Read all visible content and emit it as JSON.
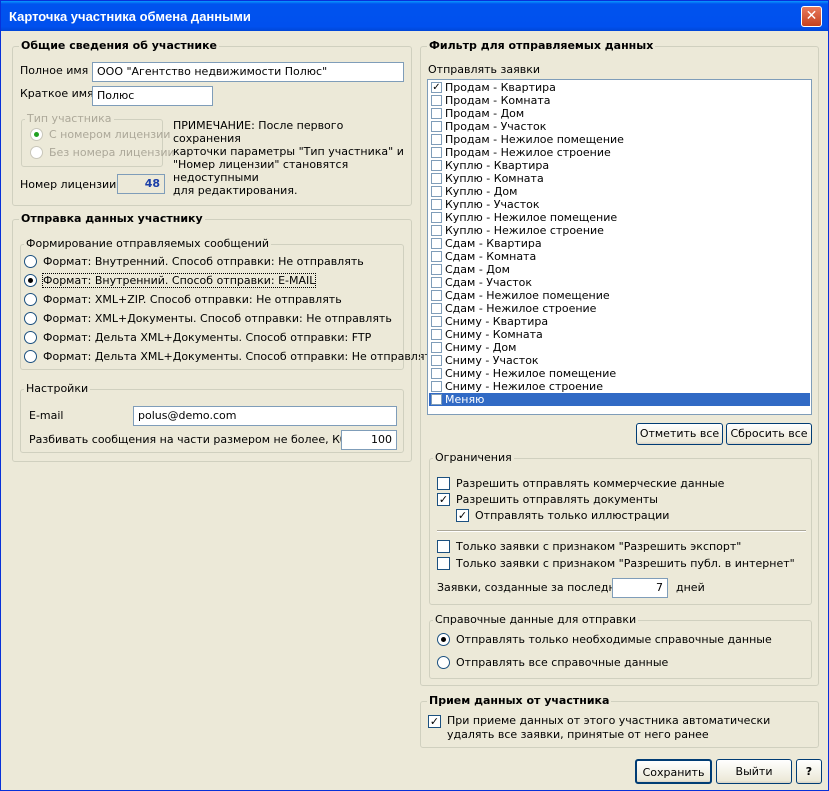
{
  "window": {
    "title": "Карточка участника обмена данными"
  },
  "general": {
    "legend": "Общие сведения об участнике",
    "full_name_label": "Полное имя",
    "full_name_value": "ООО \"Агентство недвижимости Полюс\"",
    "short_name_label": "Краткое имя",
    "short_name_value": "Полюс",
    "type_legend": "Тип участника",
    "type_options": [
      "С номером лицензии",
      "Без номера лицензии"
    ],
    "note_lines": [
      "ПРИМЕЧАНИЕ: После первого сохранения",
      "карточки параметры \"Тип участника\" и",
      "\"Номер лицензии\" становятся недоступными",
      "для редактирования."
    ],
    "license_label": "Номер лицензии",
    "license_value": "48"
  },
  "sending": {
    "legend": "Отправка данных участнику",
    "format_legend": "Формирование отправляемых сообщений",
    "format_options": [
      "Формат: Внутренний. Способ отправки: Не отправлять",
      "Формат: Внутренний. Способ отправки: E-MAIL",
      "Формат: XML+ZIP. Способ отправки: Не отправлять",
      "Формат: XML+Документы. Способ отправки: Не отправлять",
      "Формат: Дельта XML+Документы. Способ отправки: FTP",
      "Формат: Дельта XML+Документы. Способ отправки: Не отправлять"
    ],
    "format_selected": 1,
    "settings_legend": "Настройки",
    "email_label": "E-mail",
    "email_value": "polus@demo.com",
    "split_label": "Разбивать сообщения на части размером не более, Кб",
    "split_value": "100"
  },
  "filter": {
    "legend": "Фильтр для отправляемых данных",
    "list_label": "Отправлять заявки",
    "items": [
      "Продам - Квартира",
      "Продам - Комната",
      "Продам - Дом",
      "Продам - Участок",
      "Продам - Нежилое помещение",
      "Продам - Нежилое строение",
      "Куплю - Квартира",
      "Куплю - Комната",
      "Куплю - Дом",
      "Куплю - Участок",
      "Куплю - Нежилое помещение",
      "Куплю - Нежилое строение",
      "Сдам - Квартира",
      "Сдам - Комната",
      "Сдам - Дом",
      "Сдам - Участок",
      "Сдам - Нежилое помещение",
      "Сдам - Нежилое строение",
      "Сниму - Квартира",
      "Сниму - Комната",
      "Сниму - Дом",
      "Сниму - Участок",
      "Сниму - Нежилое помещение",
      "Сниму - Нежилое строение",
      "Меняю"
    ],
    "checked": [
      0
    ],
    "selected": 24,
    "check_all": "Отметить все",
    "reset_all": "Сбросить все"
  },
  "limits": {
    "legend": "Ограничения",
    "allow_commercial": "Разрешить отправлять коммерческие данные",
    "allow_docs": "Разрешить отправлять документы",
    "only_illustrations": "Отправлять только иллюстрации",
    "only_export": "Только заявки с признаком \"Разрешить экспорт\"",
    "only_internet": "Только заявки с признаком \"Разрешить публ. в интернет\"",
    "days_label": "Заявки, созданные за последние",
    "days_value": "7",
    "days_unit": "дней"
  },
  "reference": {
    "legend": "Справочные данные для отправки",
    "options": [
      "Отправлять только необходимые справочные данные",
      "Отправлять все справочные данные"
    ],
    "selected": 0
  },
  "receive": {
    "legend": "Прием данных от участника",
    "auto_delete_lines": [
      "При приеме данных от этого участника автоматически",
      "удалять все заявки, принятые от него ранее"
    ]
  },
  "buttons": {
    "save": "Сохранить",
    "exit": "Выйти",
    "help": "?"
  }
}
